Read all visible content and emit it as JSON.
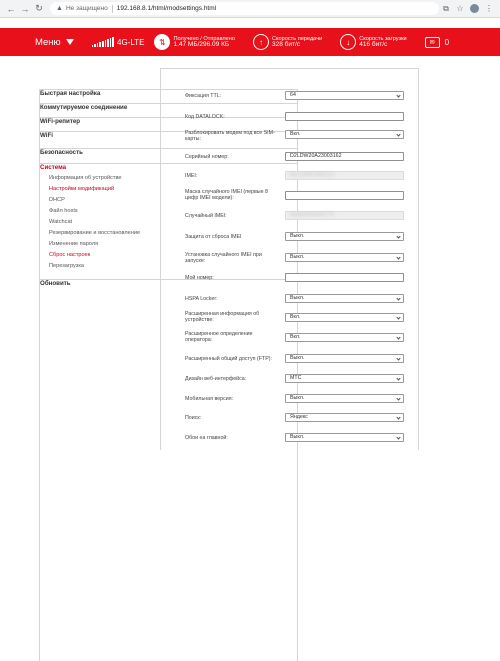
{
  "browser": {
    "not_secure": "Не защищено",
    "url": "192.168.8.1/html/modsettings.html"
  },
  "topbar": {
    "menu_label": "Меню",
    "network": "4G-LTE",
    "traffic_label": "Получено / Отправлено",
    "traffic_value": "1.47 МБ/296.09 КБ",
    "upload_label": "Скорость передачи",
    "upload_value": "328 бит/с",
    "download_label": "Скорость загрузки",
    "download_value": "416 бит/с",
    "messages_count": "0"
  },
  "sidebar": {
    "items": [
      {
        "label": "Быстрая настройка"
      },
      {
        "label": "Коммутируемое соединение"
      },
      {
        "label": "WiFi-репитер"
      },
      {
        "label": "WiFi"
      },
      {
        "label": "Безопасность"
      },
      {
        "label": "Система"
      },
      {
        "label": "Информация об устройстве"
      },
      {
        "label": "Настройки модификаций"
      },
      {
        "label": "DHCP"
      },
      {
        "label": "Файл hosts"
      },
      {
        "label": "Watchcat"
      },
      {
        "label": "Резервирование и восстановление"
      },
      {
        "label": "Изменение пароля"
      },
      {
        "label": "Сброс настроек"
      },
      {
        "label": "Перезагрузка"
      },
      {
        "label": "Обновить"
      }
    ]
  },
  "form": {
    "rows": [
      {
        "label": "Фиксация TTL:",
        "value": "64",
        "kind": "select"
      },
      {
        "label": "Код DATALOCK:",
        "value": "",
        "kind": "input"
      },
      {
        "label": "Разблокировать модем под все SIM-карты:",
        "value": "Вкл.",
        "kind": "select"
      },
      {
        "label": "Серийный номер:",
        "value": "D2LDW20A23003162",
        "kind": "input"
      },
      {
        "label": "IMEI:",
        "value": "861234567890123",
        "kind": "blur"
      },
      {
        "label": "Маска случайного IMEI (первые 8 цифр IMEI модели):",
        "value": "",
        "kind": "input"
      },
      {
        "label": "Случайный IMEI:",
        "value": "356840041845776",
        "kind": "blur"
      },
      {
        "label": "Защита от сброса IMEI",
        "value": "Выкл.",
        "kind": "select"
      },
      {
        "label": "Установка случайного IMEI при запуске:",
        "value": "Выкл.",
        "kind": "select"
      },
      {
        "label": "Мой номер:",
        "value": "",
        "kind": "input"
      },
      {
        "label": "HSPA Locker:",
        "value": "Выкл.",
        "kind": "select"
      },
      {
        "label": "Расширенная информация об устройстве:",
        "value": "Вкл.",
        "kind": "select"
      },
      {
        "label": "Расширенное определение оператора:",
        "value": "Вкл.",
        "kind": "select"
      },
      {
        "label": "Расширенный общий доступ (FTP):",
        "value": "Выкл.",
        "kind": "select"
      },
      {
        "label": "Дизайн веб-интерфейса:",
        "value": "МТС",
        "kind": "select"
      },
      {
        "label": "Мобильная версия:",
        "value": "Выкл.",
        "kind": "select"
      },
      {
        "label": "Поиск:",
        "value": "Яндекс",
        "kind": "select"
      },
      {
        "label": "Обои на главной:",
        "value": "Выкл.",
        "kind": "select"
      }
    ]
  },
  "colors": {
    "brand_red": "#e8101a",
    "active_link": "#d0021b"
  }
}
